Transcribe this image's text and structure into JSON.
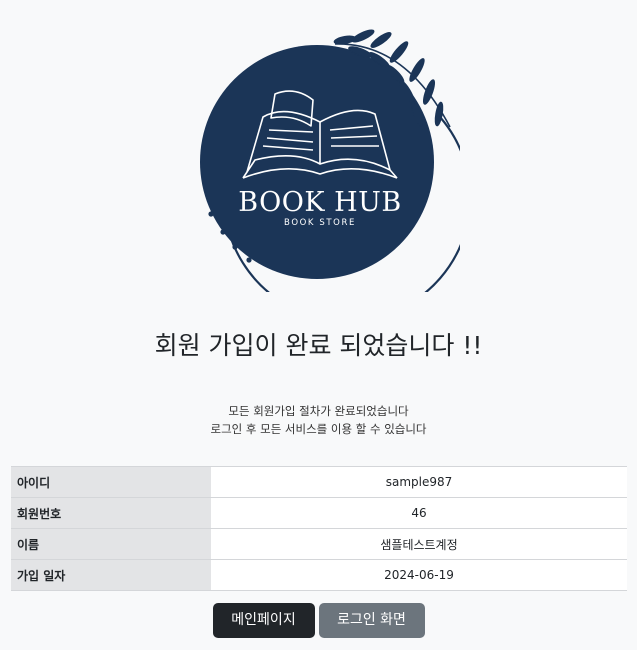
{
  "logo": {
    "brand": "BOOK HUB",
    "tagline": "BOOK STORE",
    "colors": {
      "navy": "#1b3557",
      "white": "#ffffff"
    }
  },
  "heading": "회원 가입이 완료 되었습니다 !!",
  "description": {
    "line1": "모든 회원가입 절차가 완료되었습니다",
    "line2": "로그인 후 모든 서비스를 이용 할 수 있습니다"
  },
  "info_table": {
    "rows": [
      {
        "label": "아이디",
        "value": "sample987"
      },
      {
        "label": "회원번호",
        "value": "46"
      },
      {
        "label": "이름",
        "value": "샘플테스트계정"
      },
      {
        "label": "가입 일자",
        "value": "2024-06-19"
      }
    ]
  },
  "buttons": {
    "main_page": "메인페이지",
    "login_screen": "로그인 화면"
  }
}
